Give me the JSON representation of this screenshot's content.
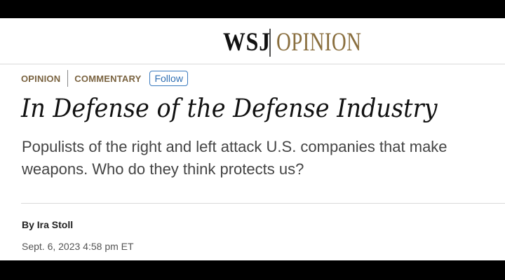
{
  "masthead": {
    "logo_wsj": "WSJ",
    "logo_section": "OPINION"
  },
  "article": {
    "topics": [
      "OPINION",
      "COMMENTARY"
    ],
    "follow_label": "Follow",
    "headline": "In Defense of the Defense Industry",
    "dek": "Populists of the right and left attack U.S. companies that make weapons. Who do they think protects us?",
    "byline_prefix": "By",
    "author": "Ira Stoll",
    "timestamp": "Sept. 6, 2023 4:58 pm ET"
  },
  "colors": {
    "opinion_gold": "#8a6f3f",
    "topic_brown": "#7a6340",
    "follow_blue": "#2f6fb3",
    "frame": "#000000"
  }
}
